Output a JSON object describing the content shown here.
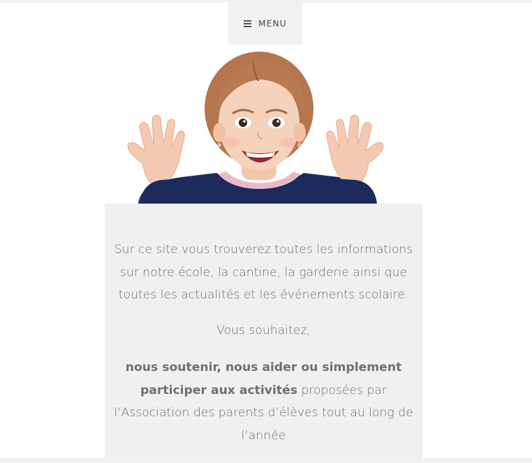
{
  "nav": {
    "menu_label": "MENU",
    "menu_icon": "hamburger-icon"
  },
  "hero": {
    "image": "photo of smiling girl raising both hands"
  },
  "content": {
    "intro_line1": "Sur ce site vous trouverez toutes les informations",
    "intro_line2": "sur notre école, la cantine, la garderie ainsi que",
    "intro_line3": "toutes les actualités et les événements scolaire.",
    "vous_souhaitez": "Vous souhaitez,",
    "cta_bold_line1": "nous soutenir, nous aider ou simplement",
    "cta_bold_line2": "participer aux activités",
    "cta_rest_line2": " proposées par",
    "cta_line3": "l’Association des parents d’élèves tout au long de",
    "cta_line4": "l’année"
  }
}
